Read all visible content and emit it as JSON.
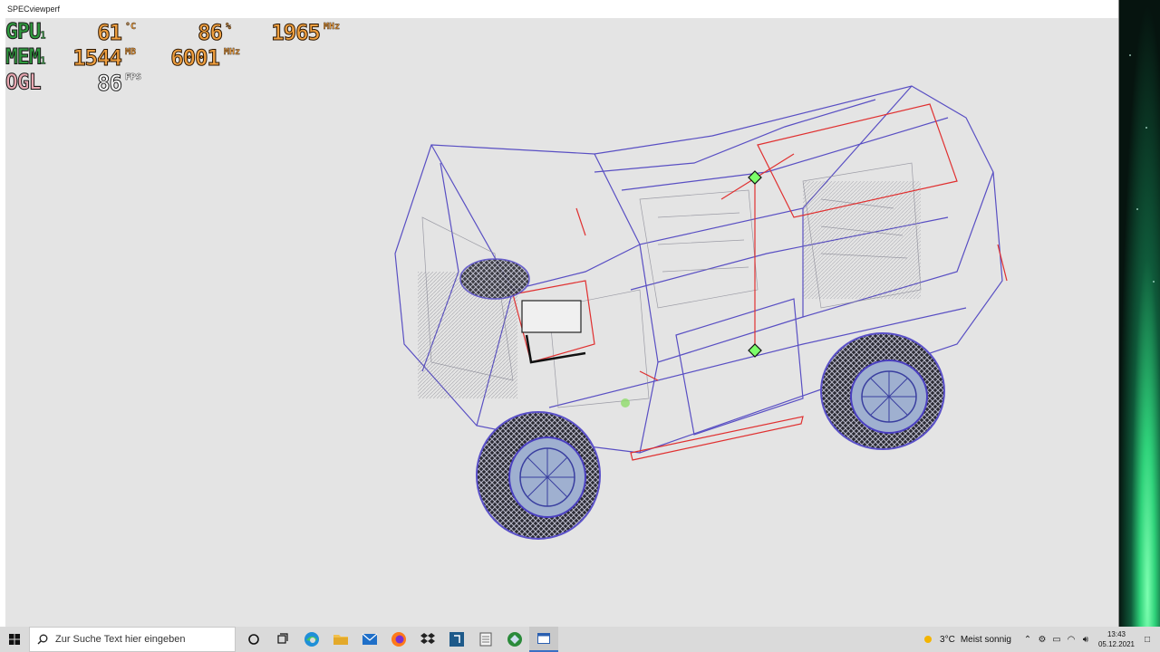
{
  "window": {
    "title": "SPECviewperf"
  },
  "osd": {
    "gpu": {
      "tag": "GPU",
      "index": "1",
      "temp": "61",
      "temp_unit": "°C",
      "load": "86",
      "load_unit": "%",
      "clock": "1965",
      "clock_unit": "MHz"
    },
    "mem": {
      "tag": "MEM",
      "index": "1",
      "used": "1544",
      "used_unit": "MB",
      "clock": "6001",
      "clock_unit": "MHz"
    },
    "ogl": {
      "tag": "OGL",
      "fps": "86",
      "fps_unit": "FPS"
    }
  },
  "taskbar": {
    "search_placeholder": "Zur Suche Text hier eingeben",
    "weather_temp": "3°C",
    "weather_text": "Meist sonnig",
    "time": "13:43",
    "date": "05.12.2021",
    "apps": [
      "windows-logo",
      "cortana",
      "task-view",
      "edge",
      "file-explorer",
      "mail",
      "firefox",
      "dropbox",
      "app-blue",
      "notepad",
      "app-green",
      "specviewperf"
    ]
  },
  "colors": {
    "osd_value": "#f0a040",
    "osd_tag_green": "#2f9a3e",
    "osd_tag_pink": "#e9a8b2",
    "wire_blue": "#4a3fc0",
    "wire_red": "#e03030"
  }
}
